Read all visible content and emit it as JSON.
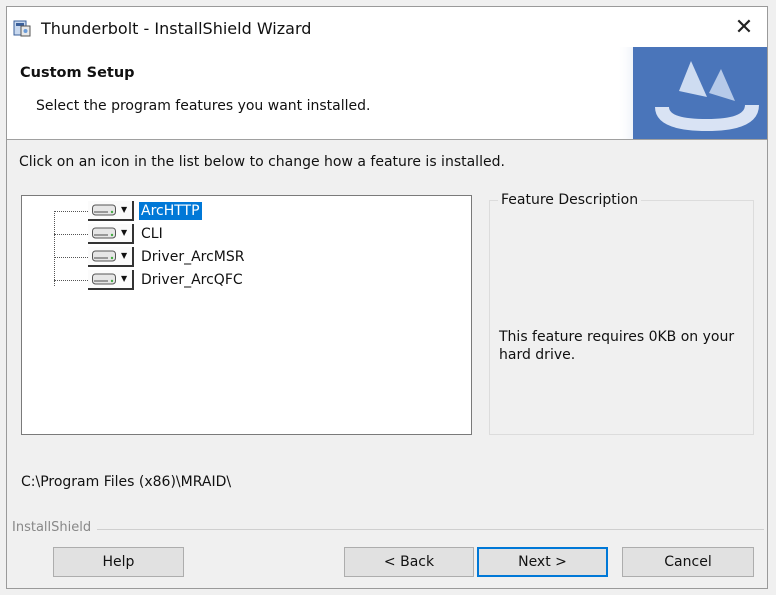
{
  "window": {
    "title": "Thunderbolt - InstallShield Wizard",
    "close_glyph": "✕"
  },
  "banner": {
    "title": "Custom Setup",
    "subtitle": "Select the program features you want installed.",
    "graphic_icon": "installshield-swirl-icon",
    "accent_color": "#3e6db5"
  },
  "instruction": "Click on an icon in the list below to change how a feature is installed.",
  "features": [
    {
      "label": "ArcHTTP",
      "selected": true,
      "icon": "hard-drive-icon"
    },
    {
      "label": "CLI",
      "selected": false,
      "icon": "hard-drive-icon"
    },
    {
      "label": "Driver_ArcMSR",
      "selected": false,
      "icon": "hard-drive-icon"
    },
    {
      "label": "Driver_ArcQFC",
      "selected": false,
      "icon": "hard-drive-icon"
    }
  ],
  "description": {
    "title": "Feature Description",
    "text": "This feature requires 0KB on your hard drive."
  },
  "install_path": "C:\\Program Files (x86)\\MRAID\\",
  "footer": {
    "brand": "InstallShield",
    "help_label": "Help",
    "back_label": "< Back",
    "next_label": "Next >",
    "cancel_label": "Cancel"
  },
  "colors": {
    "selection": "#0078d7",
    "default_button_border": "#0078d7",
    "button_face": "#e1e1e1",
    "window_bg": "#f0f0f0"
  }
}
